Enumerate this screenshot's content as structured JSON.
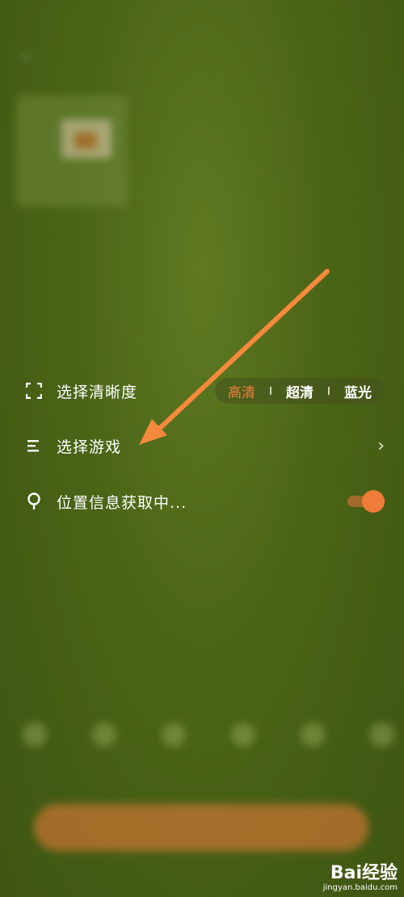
{
  "background_blurred": {
    "status_left": "",
    "status_right": "",
    "page_title": "",
    "card_name": "",
    "card_description": "",
    "card_link": "",
    "share_label": "",
    "start_button": "",
    "agreement": ""
  },
  "settings": {
    "resolution": {
      "label": "选择清晰度",
      "options": [
        "高清",
        "超清",
        "蓝光"
      ],
      "selected": "高清"
    },
    "game": {
      "label": "选择游戏"
    },
    "location": {
      "label": "位置信息获取中...",
      "toggle_on": true
    }
  },
  "colors": {
    "accent": "#f07c3a",
    "background": "#4a6416"
  },
  "icons": {
    "resolution": "fullscreen-corners-icon",
    "game": "list-icon",
    "location": "location-pin-icon",
    "chevron": "chevron-right-icon"
  },
  "watermark": {
    "main": "Bai经验",
    "sub": "jingyan.baidu.com"
  }
}
